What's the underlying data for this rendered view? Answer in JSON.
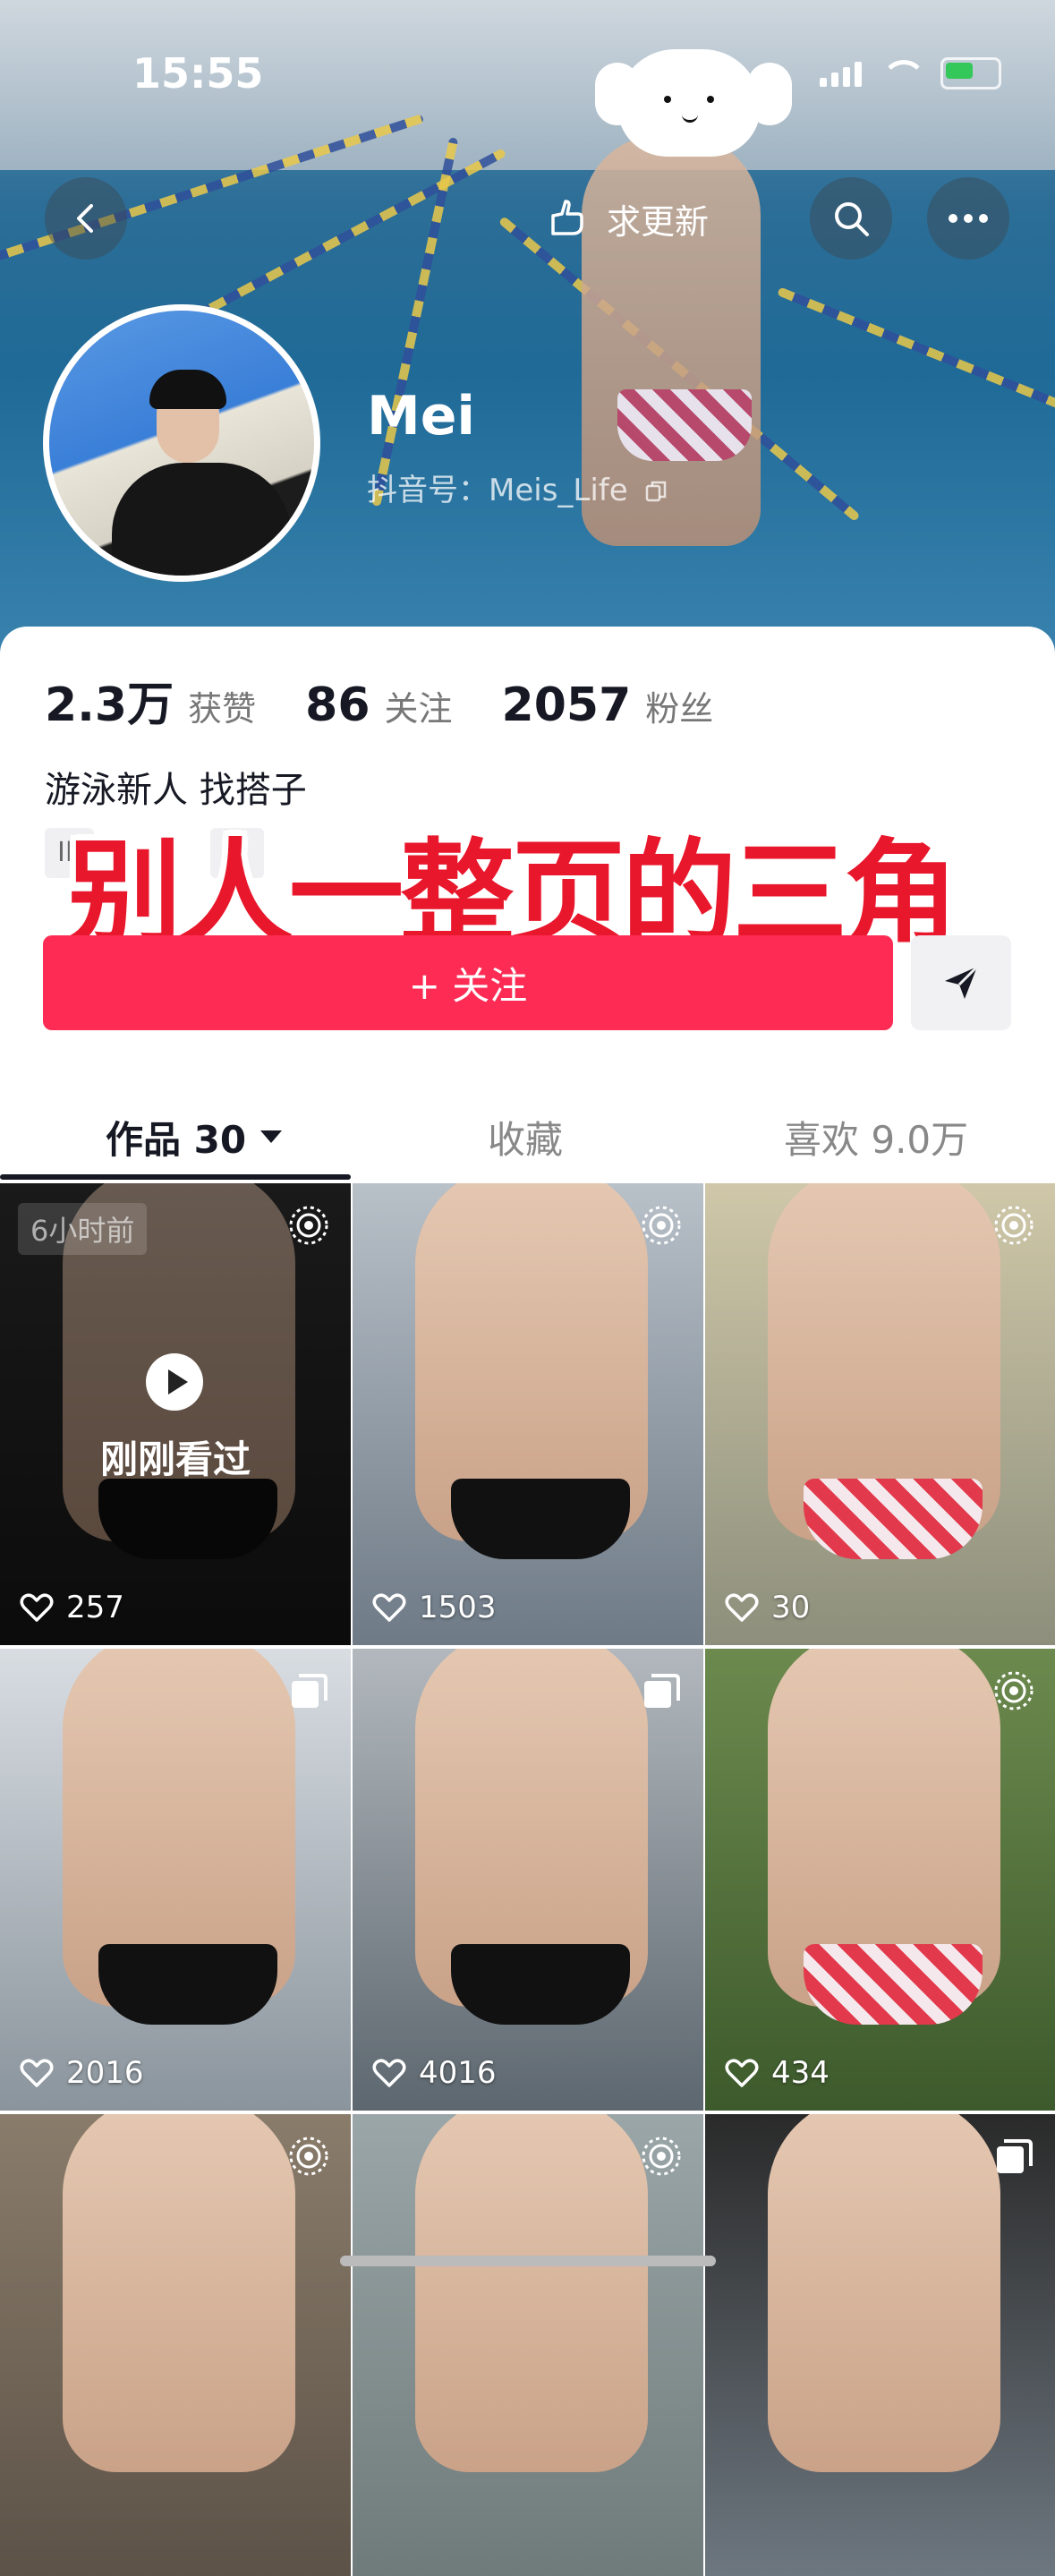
{
  "status_bar": {
    "time": "15:55"
  },
  "header": {
    "update_label": "求更新",
    "name": "Mei",
    "douyin_id": "抖音号：Meis_Life"
  },
  "stats": [
    {
      "value": "2.3万",
      "label": "获赞"
    },
    {
      "value": "86",
      "label": "关注"
    },
    {
      "value": "2057",
      "label": "粉丝"
    }
  ],
  "bio": "游泳新人 找搭子",
  "ip_tag": "IP",
  "overlay_caption": "别人一整页的三角",
  "follow_button": "+ 关注",
  "tabs": {
    "works": "作品 30",
    "collections": "收藏",
    "likes": "喜欢 9.0万"
  },
  "colors": {
    "accent": "#fe2c55",
    "caption_red": "#e8172c"
  },
  "videos": [
    {
      "likes": "257",
      "time_tag": "6小时前",
      "seen_label": "刚刚看过",
      "badge": "live-photo-icon",
      "trunks": "black"
    },
    {
      "likes": "1503",
      "badge": "live-photo-icon",
      "trunks": "black"
    },
    {
      "likes": "30",
      "badge": "live-photo-icon",
      "trunks": "hearts"
    },
    {
      "likes": "2016",
      "badge": "multi-image-icon",
      "trunks": "black"
    },
    {
      "likes": "4016",
      "badge": "multi-image-icon",
      "trunks": "black"
    },
    {
      "likes": "434",
      "badge": "live-photo-icon",
      "trunks": "hearts"
    },
    {
      "badge": "live-photo-icon"
    },
    {
      "badge": "live-photo-icon"
    },
    {
      "badge": "multi-image-icon"
    }
  ]
}
